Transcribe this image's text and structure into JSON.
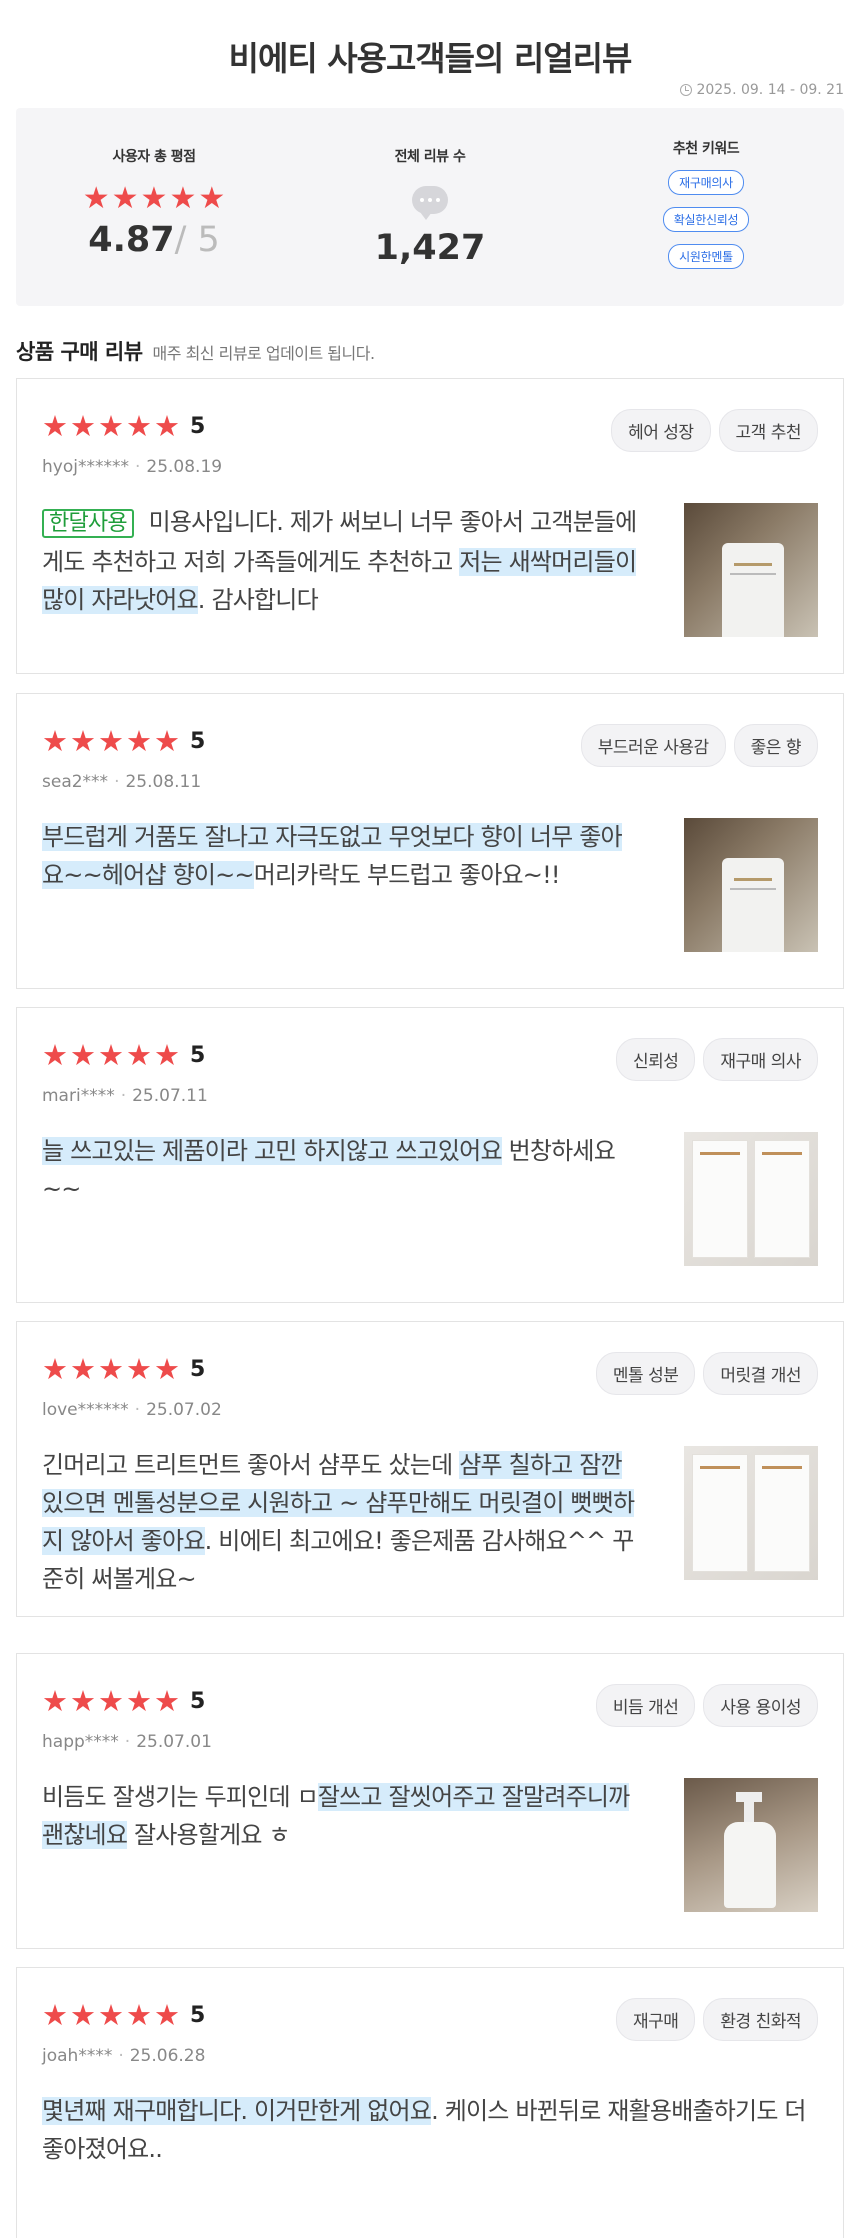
{
  "page": {
    "title": "비에티 사용고객들의 리얼리뷰",
    "date_range": "2025. 09. 14 - 09. 21"
  },
  "summary": {
    "rating_label": "사용자 총 평점",
    "rating_value": "4.87",
    "rating_max": "/ 5",
    "total_label": "전체 리뷰 수",
    "total_value": "1,427",
    "keyword_label": "추천 키워드",
    "keywords": [
      "재구매의사",
      "확실한신뢰성",
      "시원한멘톨"
    ]
  },
  "section": {
    "title": "상품 구매 리뷰",
    "subtitle": "매주 최신 리뷰로 업데이트 됩니다."
  },
  "colors": {
    "star": "#ee4b4b",
    "highlight": "#d6ecfb",
    "keyword_blue": "#2b6ee6",
    "badge_green": "#1f9d3a"
  },
  "reviews": [
    {
      "score": "5",
      "user": "hyoj******",
      "date": "25.08.19",
      "tags": [
        "헤어 성장",
        "고객 추천"
      ],
      "badge": "한달사용",
      "text_parts": [
        {
          "t": " 미용사입니다. 제가 써보니 너무 좋아서 고객분들에게도 추천하고 저희 가족들에게도 추천하고 ",
          "hl": false
        },
        {
          "t": "저는 새싹머리들이 많이 자라낫어요",
          "hl": true
        },
        {
          "t": ". 감사합니다",
          "hl": false
        }
      ],
      "photo": "shampoo-bottle-photo"
    },
    {
      "score": "5",
      "user": "sea2***",
      "date": "25.08.11",
      "tags": [
        "부드러운 사용감",
        "좋은 향"
      ],
      "badge": "",
      "text_parts": [
        {
          "t": "부드럽게 거품도 잘나고 자극도없고 무엇보다 향이 너무 좋아요~~헤어샵 향이~~",
          "hl": true
        },
        {
          "t": "머리카락도 부드럽고 좋아요~!!",
          "hl": false
        }
      ],
      "photo": "shampoo-bottle-photo"
    },
    {
      "score": "5",
      "user": "mari****",
      "date": "25.07.11",
      "tags": [
        "신뢰성",
        "재구매 의사"
      ],
      "badge": "",
      "text_parts": [
        {
          "t": "늘 쓰고있는 제품이라 고민 하지않고 쓰고있어요",
          "hl": true
        },
        {
          "t": " 번창하세요 ~~",
          "hl": false
        }
      ],
      "photo": "shampoo-box-photo"
    },
    {
      "score": "5",
      "user": "love******",
      "date": "25.07.02",
      "tags": [
        "멘톨 성분",
        "머릿결 개선"
      ],
      "badge": "",
      "text_parts": [
        {
          "t": "긴머리고 트리트먼트 좋아서 샴푸도 샀는데 ",
          "hl": false
        },
        {
          "t": "샴푸 칠하고 잠깐 있으면 멘톨성분으로 시원하고 ~ 샴푸만해도 머릿결이 뻣뻣하지 않아서 좋아요",
          "hl": true
        },
        {
          "t": ". 비에티 최고에요! 좋은제품 감사해요^^ 꾸준히 써볼게요~",
          "hl": false
        }
      ],
      "photo": "shampoo-box-photo"
    },
    {
      "score": "5",
      "user": "happ****",
      "date": "25.07.01",
      "tags": [
        "비듬 개선",
        "사용 용이성"
      ],
      "badge": "",
      "text_parts": [
        {
          "t": "비듬도 잘생기는 두피인데 ㅁ",
          "hl": false
        },
        {
          "t": "잘쓰고 잘씻어주고 잘말려주니까 괜찮네요",
          "hl": true
        },
        {
          "t": " 잘사용할게요 ㅎ",
          "hl": false
        }
      ],
      "photo": "shampoo-pump-photo"
    },
    {
      "score": "5",
      "user": "joah****",
      "date": "25.06.28",
      "tags": [
        "재구매",
        "환경 친화적"
      ],
      "badge": "",
      "text_parts": [
        {
          "t": "몇년째 재구매합니다. 이거만한게 없어요",
          "hl": true
        },
        {
          "t": ". 케이스 바뀐뒤로 재활용배출하기도 더 좋아졌어요..",
          "hl": false
        }
      ],
      "photo": ""
    }
  ]
}
